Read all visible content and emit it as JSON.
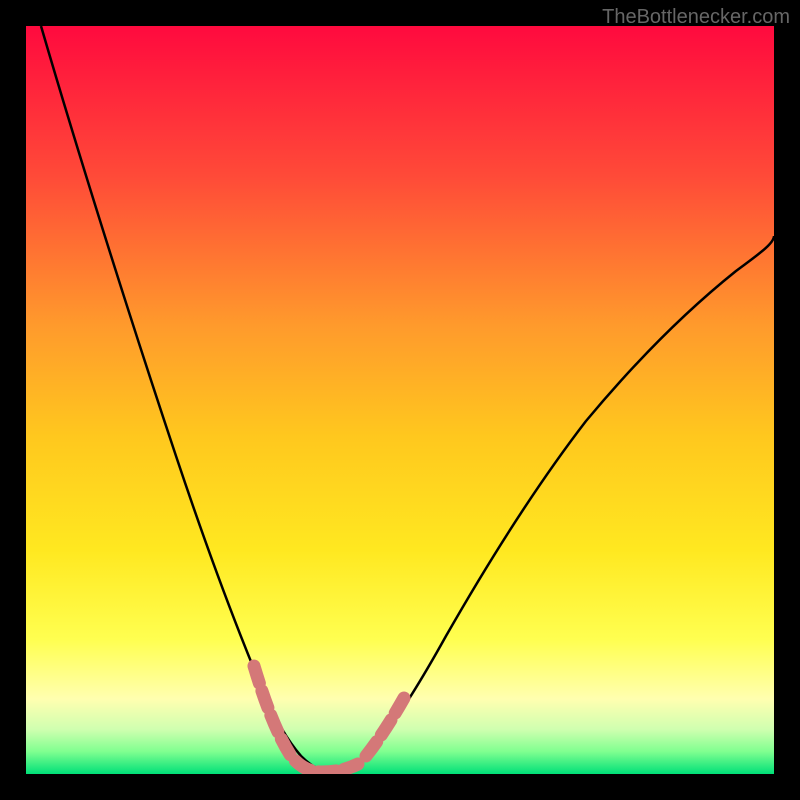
{
  "watermark": "TheBottlenecker.com",
  "chart_data": {
    "type": "line",
    "title": "",
    "xlabel": "",
    "ylabel": "",
    "xlim": [
      0,
      100
    ],
    "ylim": [
      0,
      100
    ],
    "series": [
      {
        "name": "bottleneck-curve",
        "color": "#000000",
        "x": [
          2,
          5,
          10,
          15,
          20,
          25,
          28,
          30,
          32,
          34,
          36,
          38,
          40,
          42,
          45,
          50,
          55,
          60,
          65,
          70,
          75,
          80,
          85,
          90,
          95,
          100
        ],
        "y": [
          100,
          92,
          78,
          65,
          52,
          38,
          28,
          20,
          12,
          6,
          2,
          0,
          0,
          0,
          2,
          8,
          16,
          24,
          32,
          40,
          47,
          54,
          60,
          65,
          69,
          72
        ]
      },
      {
        "name": "highlight-segment",
        "color": "#d47878",
        "x": [
          30,
          32,
          34,
          36,
          38,
          40,
          42,
          44,
          46,
          48
        ],
        "y": [
          20,
          12,
          6,
          2,
          0,
          0,
          0,
          2,
          5,
          10
        ]
      }
    ],
    "gradient_colors": {
      "top": "#ff0a3e",
      "upper_mid": "#ff7a2c",
      "mid": "#ffd500",
      "lower_mid": "#ffff50",
      "near_bottom": "#c0ff80",
      "bottom": "#00e078"
    }
  }
}
